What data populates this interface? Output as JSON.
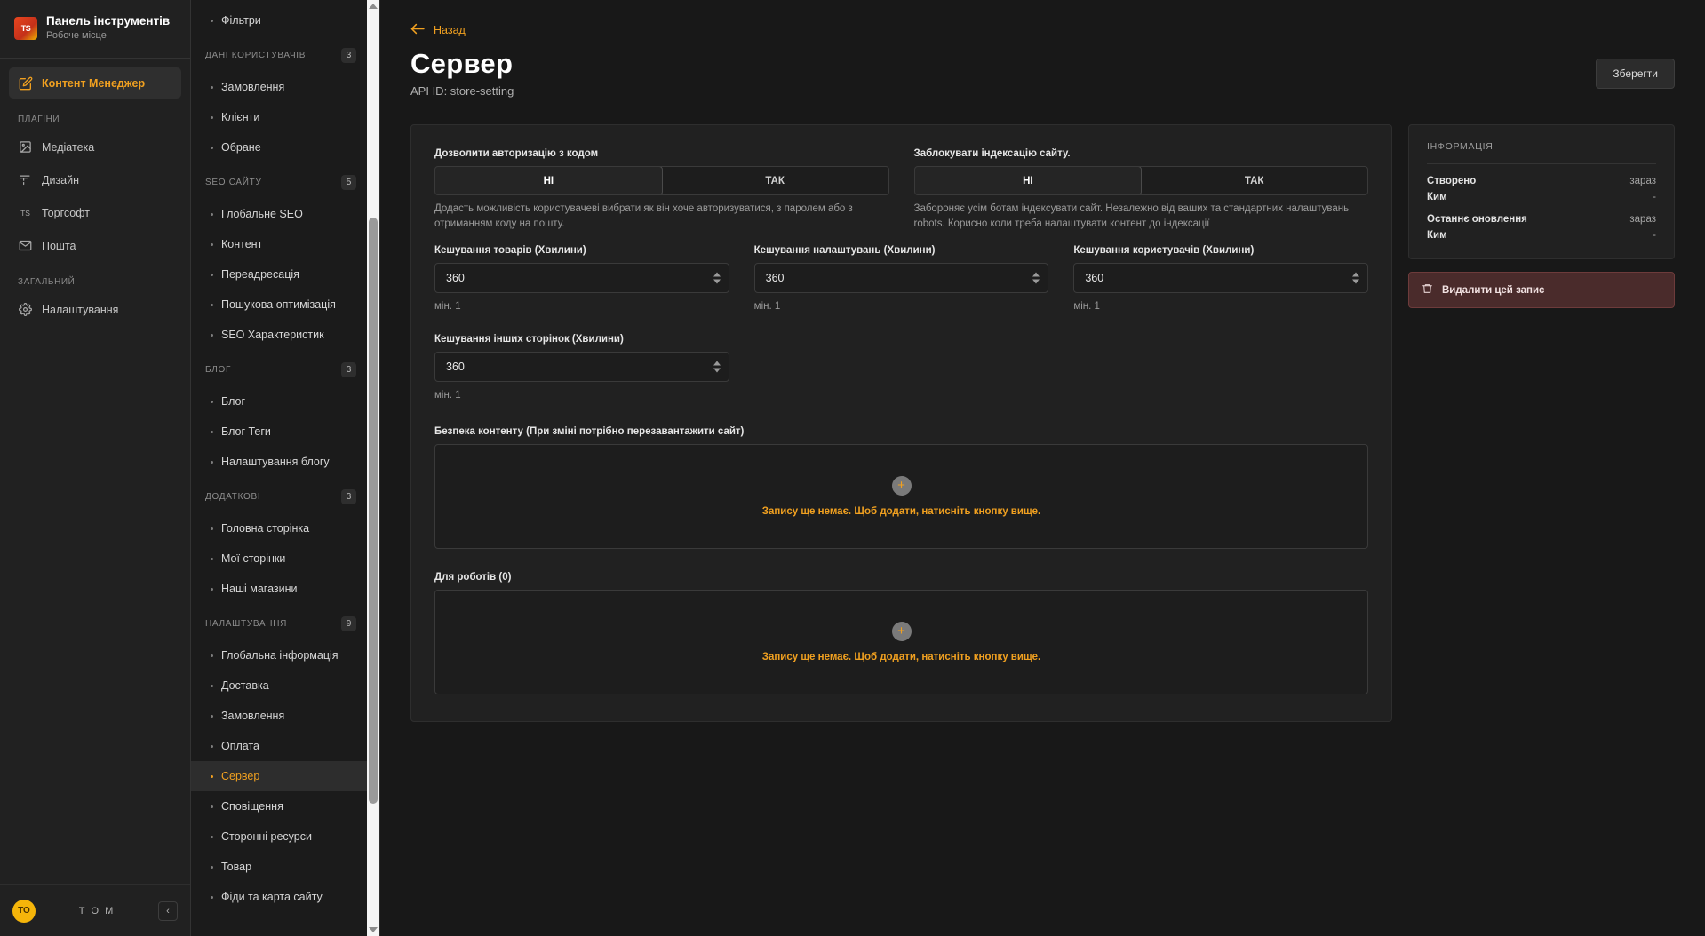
{
  "brand": {
    "logo_text": "TS",
    "title": "Панель інструментів",
    "subtitle": "Робоче місце"
  },
  "sidebar": {
    "primary_item": {
      "label": "Контент Менеджер",
      "icon": "edit-square-icon"
    },
    "groups": [
      {
        "label": "ПЛАГІНИ",
        "items": [
          {
            "label": "Медіатека",
            "icon": "image-icon"
          },
          {
            "label": "Дизайн",
            "icon": "brush-icon"
          },
          {
            "label": "Торгсофт",
            "icon": "ts-icon"
          },
          {
            "label": "Пошта",
            "icon": "mail-icon"
          }
        ]
      },
      {
        "label": "ЗАГАЛЬНИЙ",
        "items": [
          {
            "label": "Налаштування",
            "icon": "gear-icon"
          }
        ]
      }
    ],
    "footer": {
      "avatar_initials": "ТО",
      "user_name": "Т О М",
      "collapse_icon": "chevron-left-icon"
    }
  },
  "secondary_nav": {
    "top_items": [
      {
        "label": "Фільтри",
        "active": false
      }
    ],
    "sections": [
      {
        "title": "ДАНІ КОРИСТУВАЧІВ",
        "badge": "3",
        "items": [
          {
            "label": "Замовлення",
            "active": false
          },
          {
            "label": "Клієнти",
            "active": false
          },
          {
            "label": "Обране",
            "active": false
          }
        ]
      },
      {
        "title": "SEO САЙТУ",
        "badge": "5",
        "items": [
          {
            "label": "Глобальне SEO",
            "active": false
          },
          {
            "label": "Контент",
            "active": false
          },
          {
            "label": "Переадресація",
            "active": false
          },
          {
            "label": "Пошукова оптимізація",
            "active": false
          },
          {
            "label": "SEO Характеристик",
            "active": false
          }
        ]
      },
      {
        "title": "БЛОГ",
        "badge": "3",
        "items": [
          {
            "label": "Блог",
            "active": false
          },
          {
            "label": "Блог Теги",
            "active": false
          },
          {
            "label": "Налаштування блогу",
            "active": false
          }
        ]
      },
      {
        "title": "ДОДАТКОВІ",
        "badge": "3",
        "items": [
          {
            "label": "Головна сторінка",
            "active": false
          },
          {
            "label": "Мої сторінки",
            "active": false
          },
          {
            "label": "Наші магазини",
            "active": false
          }
        ]
      },
      {
        "title": "НАЛАШТУВАННЯ",
        "badge": "9",
        "items": [
          {
            "label": "Глобальна інформація",
            "active": false
          },
          {
            "label": "Доставка",
            "active": false
          },
          {
            "label": "Замовлення",
            "active": false
          },
          {
            "label": "Оплата",
            "active": false
          },
          {
            "label": "Сервер",
            "active": true
          },
          {
            "label": "Сповіщення",
            "active": false
          },
          {
            "label": "Сторонні ресурси",
            "active": false
          },
          {
            "label": "Товар",
            "active": false
          },
          {
            "label": "Фіди та карта сайту",
            "active": false
          }
        ]
      }
    ]
  },
  "header": {
    "back_label": "Назад",
    "back_icon": "arrow-left-icon",
    "title": "Сервер",
    "api_id": "API ID: store-setting",
    "save_label": "Зберегти"
  },
  "form": {
    "toggles": [
      {
        "label": "Дозволити авторизацію з кодом",
        "option_no": "НІ",
        "option_yes": "ТАК",
        "selected": "НІ",
        "help": "Додасть можливість користувачеві вибрати як він хоче авторизуватися, з паролем або з отриманням коду на пошту."
      },
      {
        "label": "Заблокувати індексацію сайту.",
        "option_no": "НІ",
        "option_yes": "ТАК",
        "selected": "НІ",
        "help": "Забороняє усім ботам індексувати сайт. Незалежно від ваших та стандартних налаштувань robots. Корисно коли треба налаштувати контент до індексації"
      }
    ],
    "numbers": [
      {
        "label": "Кешування товарів (Хвилини)",
        "value": "360",
        "help": "мін. 1"
      },
      {
        "label": "Кешування налаштувань (Хвилини)",
        "value": "360",
        "help": "мін. 1"
      },
      {
        "label": "Кешування користувачів (Хвилини)",
        "value": "360",
        "help": "мін. 1"
      },
      {
        "label": "Кешування інших сторінок (Хвилини)",
        "value": "360",
        "help": "мін. 1"
      }
    ],
    "repeaters": [
      {
        "label": "Безпека контенту (При зміні потрібно перезавантажити сайт)",
        "add_icon": "plus-icon",
        "empty_text": "Запису ще немає. Щоб додати, натисніть кнопку вище."
      },
      {
        "label": "Для роботів (0)",
        "add_icon": "plus-icon",
        "empty_text": "Запису ще немає. Щоб додати, натисніть кнопку вище."
      }
    ]
  },
  "info_panel": {
    "heading": "ІНФОРМАЦІЯ",
    "rows": [
      {
        "key": "Створено",
        "value": "зараз"
      },
      {
        "key": "Ким",
        "value": "-"
      },
      {
        "key": "Останнє оновлення",
        "value": "зараз"
      },
      {
        "key": "Ким",
        "value": "-"
      }
    ],
    "delete_label": "Видалити цей запис",
    "delete_icon": "trash-icon"
  },
  "colors": {
    "accent": "#f0a020",
    "page_bg": "#181818",
    "panel_bg": "#212121",
    "danger_bg": "#4a2b2b"
  }
}
